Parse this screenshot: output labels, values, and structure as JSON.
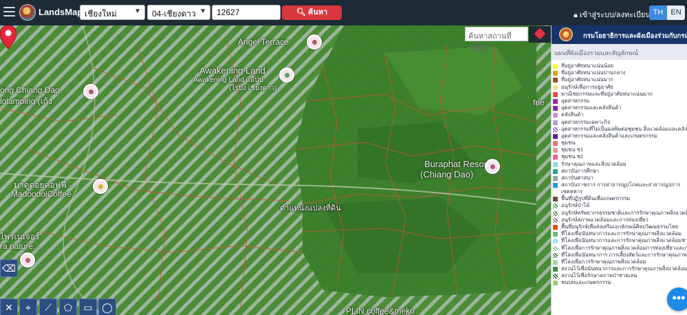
{
  "header": {
    "brand": "LandsMaps",
    "province_select": "เชียงใหม่",
    "district_select": "04-เชียงดาว",
    "parcel_input": "12627",
    "search_button": "ค้นหา",
    "login_label": "เข้าสู่ระบบ/ลงทะเบียน",
    "lang_th": "TH",
    "lang_en": "EN"
  },
  "map": {
    "search_placeholder": "ค้นหาสถานที่สำคัญ",
    "pin_label": "ตำแหน่งแปลงที่ดิน",
    "places": {
      "angel_terrace": "Angel Terrace",
      "awakening_land": "Awakening Land",
      "awakening_land_th": "Awakening Land แอ๊ปป",
      "awakening_land_sub": "(ไร่ปิ่ง เชียงดาว)",
      "ong_chiang_dao": "ong Chiang Dao",
      "glamping": "lglamping (เก้ง",
      "madoodoi_th": "มาดูดอยคอฟฟี่ -",
      "madoodoi": "MadoodoiCoffee",
      "buraphat": "Buraphat Resort",
      "buraphat_sub": "(Chiang Dao)",
      "nature_th": "ไพรเนเจอร์",
      "nature": "ra nature...",
      "friend": "frie",
      "bottom_coffee": "PLIN coffee&meko"
    },
    "colors": {
      "vegetation": "#4c8a3a",
      "parcel_line": "#c8553a",
      "stripe": "#b9c3c0",
      "pin": "#e8253c"
    }
  },
  "panel": {
    "title": "กรมโยธาธิการและผังเมืองร่วมกับกรมที่ดิน",
    "subtitle": "แผนที่ผังเมืองรวมและสัญลักษณ์",
    "legend": [
      {
        "label": "ที่อยู่อาศัยหนาแน่นน้อย",
        "color": "#ffff33"
      },
      {
        "label": "ที่อยู่อาศัยหนาแน่นปานกลาง",
        "color": "#f39c12"
      },
      {
        "label": "ที่อยู่อาศัยหนาแน่นมาก",
        "color": "#a0522d"
      },
      {
        "label": "อนุรักษ์เพื่อการอยู่อาศัย",
        "color": "#f1c40f",
        "hatch": true
      },
      {
        "label": "พาณิชยกรรมและที่อยู่อาศัยหนาแน่นมาก",
        "color": "#e74c3c"
      },
      {
        "label": "อุตสาหกรรม",
        "color": "#9b27b0"
      },
      {
        "label": "อุตสาหกรรมและคลังสินค้า",
        "color": "#8e24aa"
      },
      {
        "label": "คลังสินค้า",
        "color": "#ce93d8"
      },
      {
        "label": "อุตสาหกรรมเฉพาะกิจ",
        "color": "#b39ddb"
      },
      {
        "label": "อุตสาหกรรมที่ไม่เป็นมลพิษต่อชุมชน สิ่งแวดล้อมและคลังสินค้า",
        "color": "#7e57c2",
        "hatch": true
      },
      {
        "label": "อุตสาหกรรมและคลังสินค้าและเกษตรกรรม",
        "color": "#6a1b9a"
      },
      {
        "label": "ชุมชน",
        "color": "#e57373"
      },
      {
        "label": "ชุมชน ช1",
        "color": "#ef9a9a"
      },
      {
        "label": "ชุมชน ช2",
        "color": "#f06292"
      },
      {
        "label": "รักษาคุณภาพและสิ่งแวดล้อม",
        "color": "#80deea"
      },
      {
        "label": "สถาบันการศึกษา",
        "color": "#26a69a"
      },
      {
        "label": "สถาบันศาสนา",
        "color": "#90a4ae"
      },
      {
        "label": "สถาบันราชการ การสาธารณูปโภคและสาธารณูปการ เขตทหาร",
        "color": "#2196f3",
        "tall": true
      },
      {
        "label": "พื้นที่ปฏิรูปที่ดินเพื่อเกษตรกรรม",
        "color": "#6d4c41"
      },
      {
        "label": "อนุรักษ์ป่าไม้",
        "color": "#43a047",
        "hatch": true
      },
      {
        "label": "อนุรักษ์ทรัพยากรธรรมชาติและการรักษาคุณภาพสิ่งแวดล้อม",
        "color": "#558b2f",
        "hatch": true
      },
      {
        "label": "อนุรักษ์สภาพแวดล้อมและการท่องเที่ยว",
        "color": "#8d6e63",
        "hatch": true
      },
      {
        "label": "พื้นที่อนุรักษ์เพื่อส่งเสริมเอกลักษณ์ศิลปวัฒนธรรมไทย",
        "color": "#e65100"
      },
      {
        "label": "ที่โล่งเพื่อนันทนาการและการรักษาคุณภาพสิ่งแวดล้อม",
        "color": "#66bb6a"
      },
      {
        "label": "ที่โล่งเพื่อนันทนาการและการรักษาคุณภาพสิ่งแวดล้อมชายฝั่ง",
        "color": "#4dd0e1",
        "hatch": true
      },
      {
        "label": "ที่โล่งเพื่อการรักษาคุณภาพสิ่งแวดล้อมการท่องเที่ยวและการ",
        "color": "#81c784",
        "hatch": true
      },
      {
        "label": "ที่โล่งเพื่อนันทนาการ การเลี้ยงสัตว์และการรักษาคุณภาพสิ่งแวดล้อม",
        "color": "#2e7d32",
        "hatch": true
      },
      {
        "label": "ที่โล่งเพื่อการรักษาคุณภาพสิ่งแวดล้อม",
        "color": "#a5d6a7"
      },
      {
        "label": "สงวนไว้เพื่อนันทนาการและการรักษาคุณภาพสิ่งแวดล้อม",
        "color": "#388e3c"
      },
      {
        "label": "สงวนไว้เพื่อรักษาสภาพป่าชายเลน",
        "color": "#1b5e20",
        "hatch": true
      },
      {
        "label": "ชนบทและเกษตรกรรม",
        "color": "#9ccc65"
      }
    ]
  }
}
